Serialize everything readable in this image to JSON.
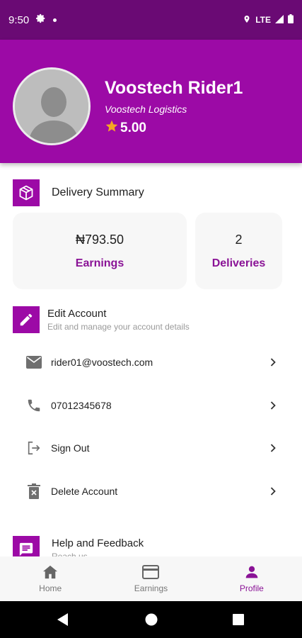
{
  "status_bar": {
    "time": "9:50",
    "network": "LTE"
  },
  "profile": {
    "name": "Voostech Rider1",
    "company": "Voostech Logistics",
    "rating": "5.00"
  },
  "delivery_summary": {
    "title": "Delivery Summary",
    "earnings_value": "₦793.50",
    "earnings_label": "Earnings",
    "deliveries_value": "2",
    "deliveries_label": "Deliveries"
  },
  "edit_account": {
    "title": "Edit Account",
    "subtitle": "Edit and manage your account details"
  },
  "account_rows": {
    "email": "rider01@voostech.com",
    "phone": "07012345678",
    "sign_out": "Sign Out",
    "delete_account": "Delete Account"
  },
  "help": {
    "title": "Help and Feedback",
    "subtitle": "Reach us"
  },
  "bottom_nav": {
    "home": "Home",
    "earnings": "Earnings",
    "profile": "Profile"
  },
  "colors": {
    "primary": "#9c0aa6",
    "status_bar": "#6a0a74",
    "accent_text": "#8a1396",
    "star": "#f5a623"
  },
  "icons": [
    "settings-icon",
    "location-icon",
    "signal-icon",
    "battery-icon",
    "box-icon",
    "pencil-icon",
    "email-icon",
    "phone-icon",
    "sign-out-icon",
    "delete-icon",
    "chevron-right-icon",
    "chat-icon",
    "home-icon",
    "card-icon",
    "person-icon",
    "back-icon",
    "home-circle-icon",
    "recents-icon"
  ]
}
